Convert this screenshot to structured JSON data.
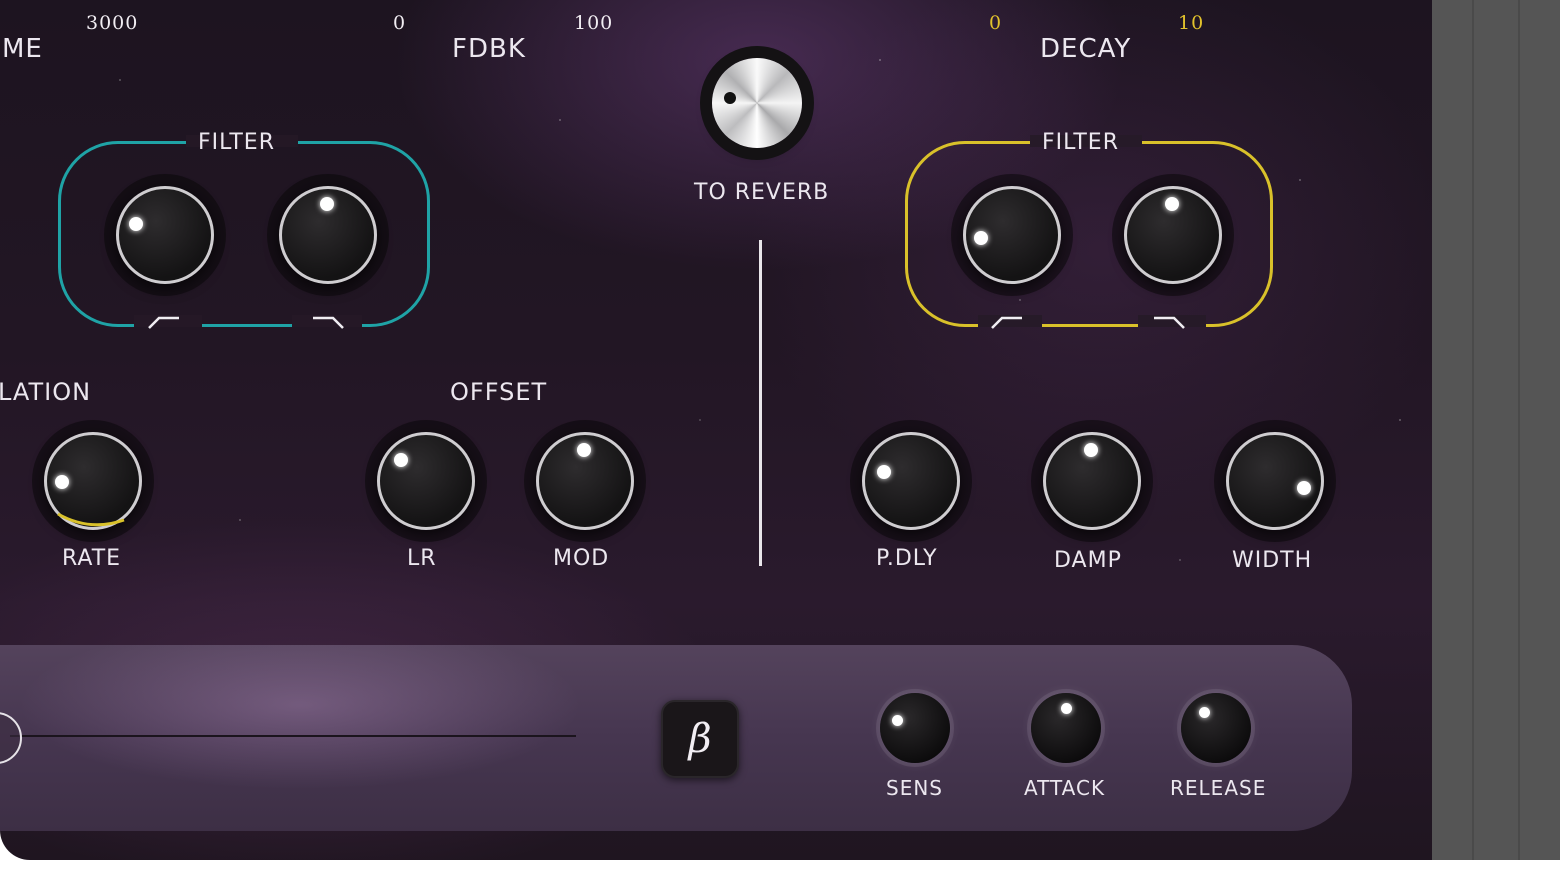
{
  "header": {
    "scale_left_max": "3000",
    "scale_fdbk_min": "0",
    "scale_fdbk_max": "100",
    "scale_decay_min": "0",
    "scale_decay_max": "10",
    "time_label_partial": "ME",
    "fdbk_label": "FDBK",
    "decay_label": "DECAY"
  },
  "delay_section": {
    "filter_label": "FILTER",
    "modulation_label_partial": "LATION",
    "offset_label": "OFFSET",
    "rate_label": "RATE",
    "lr_label": "LR",
    "mod_label": "MOD"
  },
  "center": {
    "to_reverb_label": "TO REVERB"
  },
  "reverb_section": {
    "filter_label": "FILTER",
    "pdly_label": "P.DLY",
    "damp_label": "DAMP",
    "width_label": "WIDTH"
  },
  "bottom": {
    "beta_label": "β",
    "sens_label": "SENS",
    "attack_label": "ATTACK",
    "release_label": "RELEASE"
  },
  "colors": {
    "delay_accent": "#1fa3a6",
    "reverb_accent": "#d9c12a",
    "scale_decay_color": "#e2c22c"
  }
}
